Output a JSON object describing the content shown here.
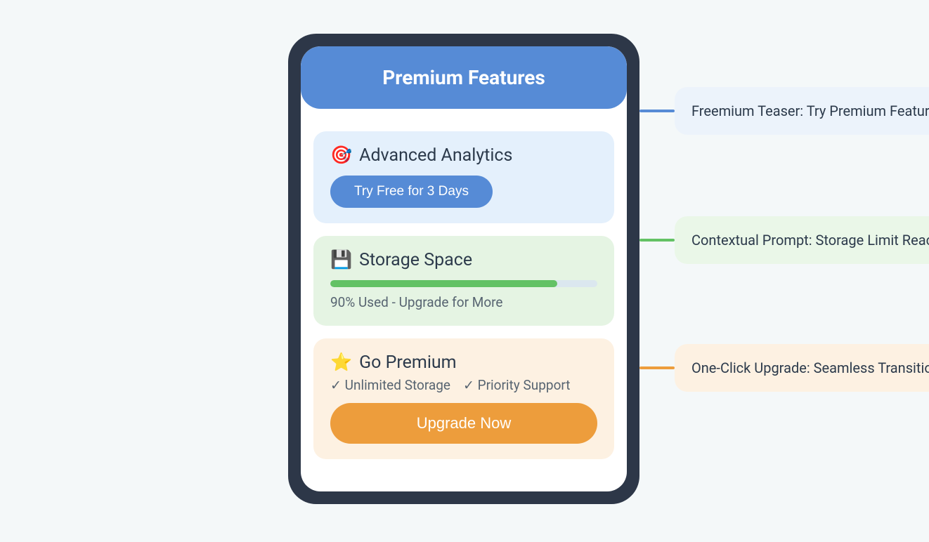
{
  "header": {
    "title": "Premium Features"
  },
  "cards": {
    "analytics": {
      "icon": "🎯",
      "title": "Advanced Analytics",
      "cta": "Try Free for 3 Days"
    },
    "storage": {
      "icon": "💾",
      "title": "Storage Space",
      "progress_percent": 90,
      "status": "90% Used - Upgrade for More"
    },
    "premium": {
      "icon": "⭐",
      "title": "Go Premium",
      "benefits": [
        "✓ Unlimited Storage",
        "✓ Priority Support"
      ],
      "cta": "Upgrade Now"
    }
  },
  "annotations": {
    "blue": "Freemium Teaser: Try Premium Features",
    "green": "Contextual Prompt: Storage Limit Reached",
    "orange": "One-Click Upgrade: Seamless Transition"
  },
  "colors": {
    "bg": "#f4f8f9",
    "phone_frame": "#2d3748",
    "primary_blue": "#568bd6",
    "primary_green": "#63c265",
    "primary_orange": "#ed9d3c"
  }
}
